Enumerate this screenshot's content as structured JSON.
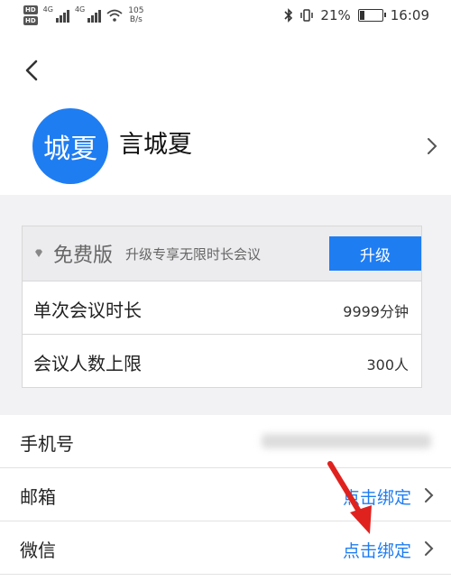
{
  "status_bar": {
    "hd1": "HD",
    "hd2": "HD",
    "net1": "4G",
    "net2": "4G",
    "speed_value": "105",
    "speed_unit": "B/s",
    "battery_percent": "21%",
    "battery_level": 0.21,
    "time": "16:09"
  },
  "profile": {
    "avatar_text": "城夏",
    "name": "言城夏"
  },
  "plan": {
    "name": "免费版",
    "description": "升级专享无限时长会议",
    "upgrade_label": "升级",
    "rows": [
      {
        "label": "单次会议时长",
        "value": "9999分钟"
      },
      {
        "label": "会议人数上限",
        "value": "300人"
      }
    ]
  },
  "account": {
    "phone_label": "手机号",
    "email_label": "邮箱",
    "email_action": "点击绑定",
    "wechat_label": "微信",
    "wechat_action": "点击绑定"
  },
  "colors": {
    "accent": "#1f7df2",
    "annotation_arrow": "#e0221f"
  }
}
